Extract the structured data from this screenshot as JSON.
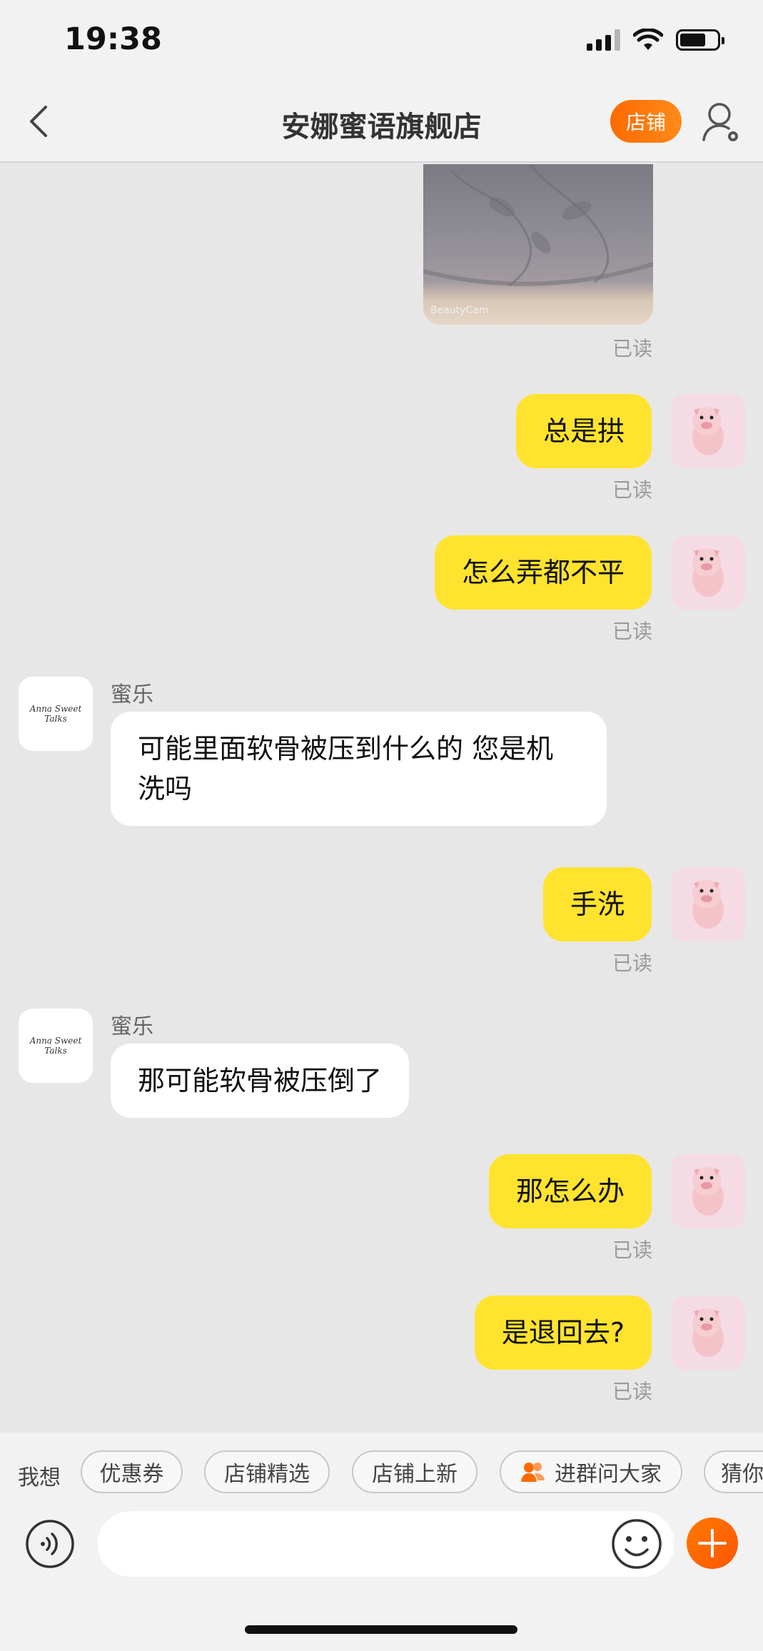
{
  "status_bar": {
    "time": "19:38"
  },
  "nav": {
    "title": "安娜蜜语旗舰店",
    "shop_button": "店铺"
  },
  "photo": {
    "watermark": "BeautyCam"
  },
  "read_label": "已读",
  "messages": [
    {
      "from": "me",
      "text": "总是拱",
      "status": "已读"
    },
    {
      "from": "me",
      "text": "怎么弄都不平",
      "status": "已读"
    },
    {
      "from": "them",
      "sender": "蜜乐",
      "text": "可能里面软骨被压到什么的 您是机洗吗"
    },
    {
      "from": "me",
      "text": "手洗",
      "status": "已读"
    },
    {
      "from": "them",
      "sender": "蜜乐",
      "text": "那可能软骨被压倒了"
    },
    {
      "from": "me",
      "text": "那怎么办",
      "status": "已读"
    },
    {
      "from": "me",
      "text": "是退回去?",
      "status": "已读"
    }
  ],
  "shop_avatar_text": "Anna Sweet Talks",
  "quick_bar": {
    "label": "我想",
    "chips": [
      "优惠券",
      "店铺精选",
      "店铺上新",
      "进群问大家",
      "猜你"
    ]
  },
  "input": {
    "placeholder": ""
  },
  "colors": {
    "my_bubble": "#ffe32e",
    "their_bubble": "#ffffff",
    "accent": "#ff6a00",
    "background": "#e7e7e7"
  }
}
